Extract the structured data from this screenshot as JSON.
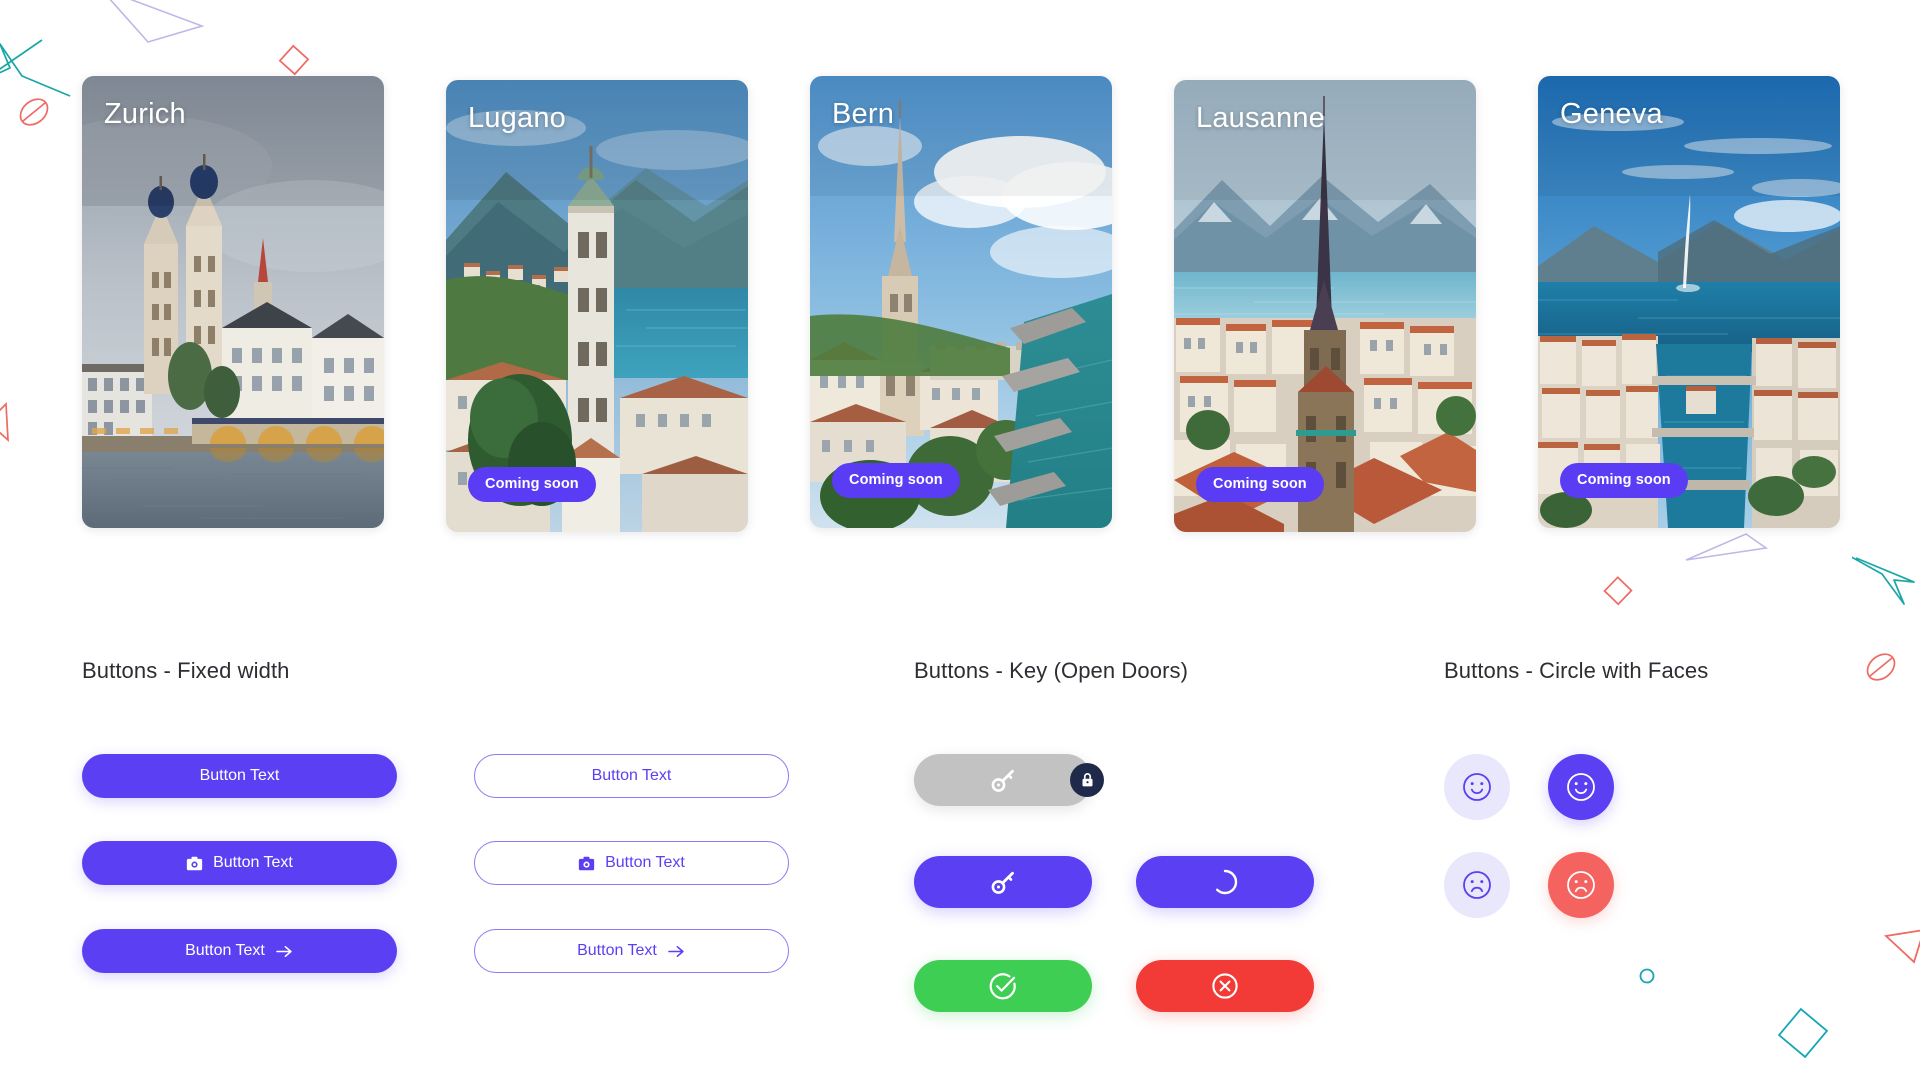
{
  "page": {
    "background_color": "#ffffff",
    "accent_color": "#5B3FF3",
    "heading_color": "#2d2d33"
  },
  "cards": {
    "badge_label": "Coming soon",
    "items": [
      {
        "name": "Zurich",
        "title": "Zurich",
        "has_badge": false,
        "badge": ""
      },
      {
        "name": "Lugano",
        "title": "Lugano",
        "has_badge": true,
        "badge": "Coming soon"
      },
      {
        "name": "Bern",
        "title": "Bern",
        "has_badge": true,
        "badge": "Coming soon"
      },
      {
        "name": "Lausanne",
        "title": "Lausanne",
        "has_badge": true,
        "badge": "Coming soon"
      },
      {
        "name": "Geneva",
        "title": "Geneva",
        "has_badge": true,
        "badge": "Coming soon"
      }
    ]
  },
  "sections": {
    "fixed_width": {
      "title": "Buttons - Fixed width",
      "filled": [
        {
          "label": "Button Text",
          "icon": "none"
        },
        {
          "label": "Button Text",
          "icon": "camera-icon"
        },
        {
          "label": "Button Text",
          "icon": "arrow-right-icon"
        }
      ],
      "outline": [
        {
          "label": "Button Text",
          "icon": "none"
        },
        {
          "label": "Button Text",
          "icon": "camera-icon"
        },
        {
          "label": "Button Text",
          "icon": "arrow-right-icon"
        }
      ]
    },
    "key_open_doors": {
      "title": "Buttons - Key (Open Doors)",
      "buttons": [
        {
          "state": "disabled",
          "icon": "key-icon",
          "badge_icon": "lock-icon",
          "color": "#C2C2C2"
        },
        {
          "state": "active",
          "icon": "key-icon",
          "badge_icon": "",
          "color": "#5B3FF3"
        },
        {
          "state": "loading",
          "icon": "spinner-icon",
          "badge_icon": "",
          "color": "#5B3FF3"
        },
        {
          "state": "success",
          "icon": "check-circle-icon",
          "badge_icon": "",
          "color": "#3ECE54"
        },
        {
          "state": "error",
          "icon": "error-circle-icon",
          "badge_icon": "",
          "color": "#F23B36"
        }
      ]
    },
    "circle_faces": {
      "title": "Buttons - Circle with Faces",
      "buttons": [
        {
          "state": "happy-inactive",
          "icon": "smiley-happy-icon",
          "bg": "#E9E7FB",
          "fg": "#5B3FF3"
        },
        {
          "state": "happy-active",
          "icon": "smiley-happy-icon",
          "bg": "#5B3FF3",
          "fg": "#ffffff"
        },
        {
          "state": "sad-inactive",
          "icon": "smiley-sad-icon",
          "bg": "#E9E7FB",
          "fg": "#5B3FF3"
        },
        {
          "state": "sad-active",
          "icon": "smiley-sad-icon",
          "bg": "#F4635F",
          "fg": "#ffffff"
        }
      ]
    }
  },
  "decorations": {
    "colors": {
      "teal": "#1AA6A6",
      "red": "#EE6A62",
      "lilac": "#BEB8E8"
    },
    "shapes": [
      "arrow-teal-topleft",
      "circle-slash-red-left",
      "diamond-red-top",
      "triangle-lilac-top",
      "triangle-red-left",
      "diamond-red-mid",
      "triangle-lilac-right",
      "arrow-teal-right",
      "circle-slash-red-right",
      "circle-teal-small",
      "diamond-teal-bottom",
      "triangle-red-right"
    ]
  }
}
